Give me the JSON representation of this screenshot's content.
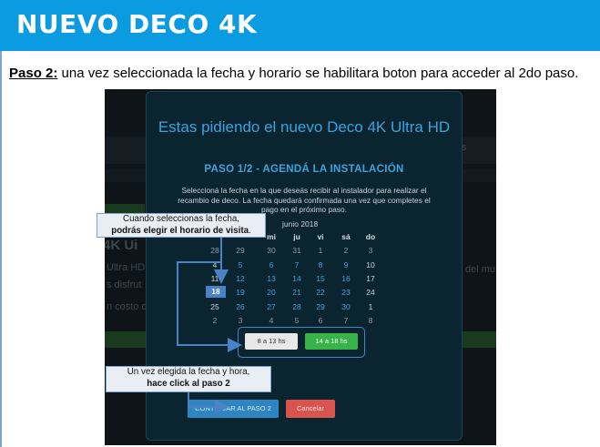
{
  "banner": {
    "title": "NUEVO DECO 4K"
  },
  "step": {
    "label": "Paso 2:",
    "text": " una vez seleccionada la fecha y horario se habilitara boton para acceder al 2do paso."
  },
  "background": {
    "left_big": "4K Ui",
    "left_line1": "Ultra HD",
    "left_line2": "s disfrut",
    "left_line3": "n costo d",
    "right_es": "es",
    "right_mu": "del mu"
  },
  "modal": {
    "title": "Estas pidiendo el nuevo Deco 4K Ultra HD",
    "subtitle": "PASO 1/2 - AGENDÁ LA INSTALACIÓN",
    "description": "Seleccioná la fecha en la que deseás recibir al instalador para realizar el recambio de deco. La fecha quedará confirmada una vez que completes el pago en el próximo paso.",
    "calendar": {
      "month": "junio 2018",
      "weekdays": [
        "mi",
        "ju",
        "vi",
        "sá",
        "do"
      ],
      "rows": [
        [
          "28",
          "29",
          "30",
          "31",
          "1",
          "2",
          "3"
        ],
        [
          "4",
          "5",
          "6",
          "7",
          "8",
          "9",
          "10"
        ],
        [
          "11",
          "12",
          "13",
          "14",
          "15",
          "16",
          "17"
        ],
        [
          "18",
          "19",
          "20",
          "21",
          "22",
          "23",
          "24"
        ],
        [
          "25",
          "26",
          "27",
          "28",
          "29",
          "30",
          "1"
        ],
        [
          "2",
          "3",
          "4",
          "5",
          "6",
          "7",
          "8"
        ]
      ],
      "selected": "18"
    },
    "time_slots": [
      {
        "label": "8 a 13 hs"
      },
      {
        "label": "14 a 18 hs"
      }
    ],
    "continue_button": "CONTINUAR AL PASO 2",
    "cancel_button": "Cancelar"
  },
  "callouts": {
    "first_line1": "Cuando seleccionas la fecha,",
    "first_line2": "podrás elegir el horario de visita",
    "first_suffix": ".",
    "second_line1": "Un vez elegida la fecha y hora,",
    "second_line2": "hace click al paso 2"
  },
  "colors": {
    "banner": "#0a9be0",
    "modal_bg": "#0b2530",
    "accent_blue": "#3aa3e0",
    "selected_day": "#4a82c7",
    "selected_slot": "#37b34a",
    "cancel": "#d9534f"
  }
}
